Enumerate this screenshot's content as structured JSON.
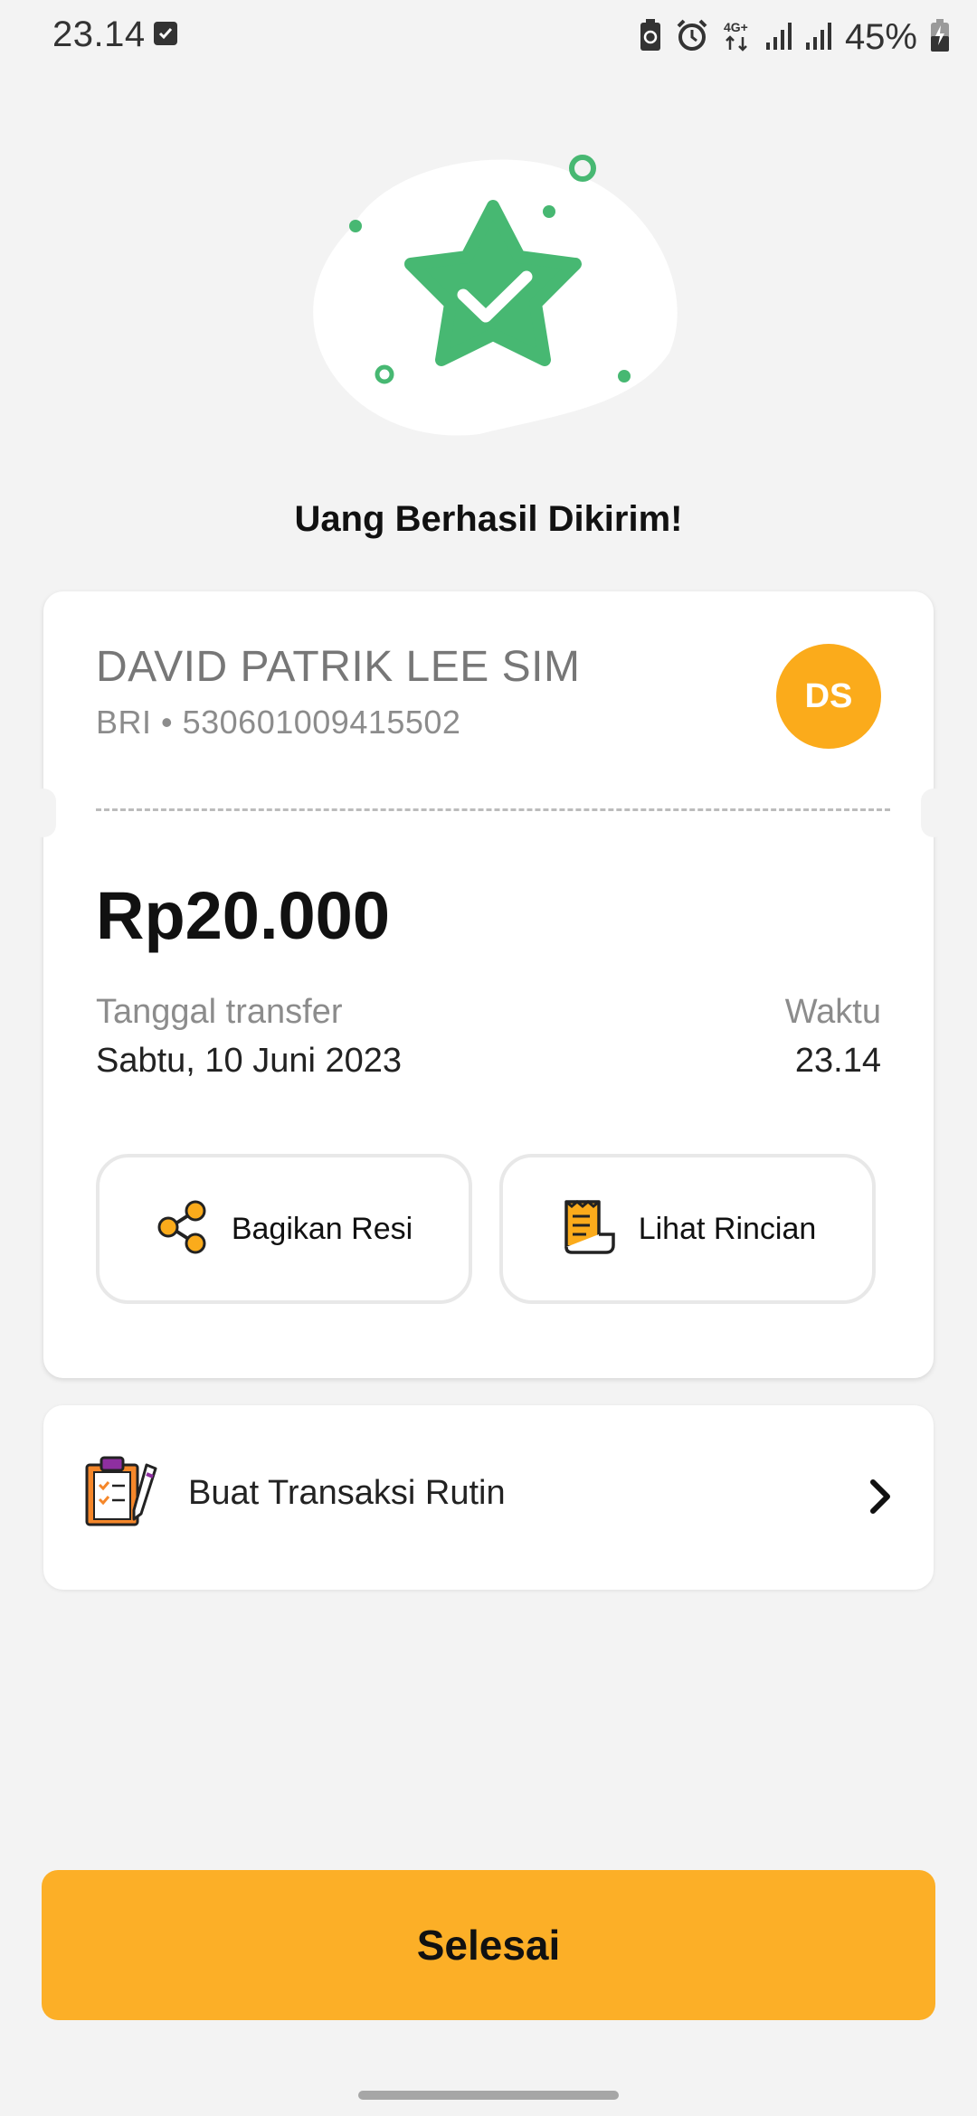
{
  "status_bar": {
    "time": "23.14",
    "network_label": "4G+",
    "battery_percent": "45%"
  },
  "success": {
    "title": "Uang Berhasil Dikirim!",
    "accent_color": "#47b872"
  },
  "recipient": {
    "name": "DAVID PATRIK LEE SIM",
    "account": "BRI • 530601009415502",
    "initials": "DS",
    "avatar_color": "#fbab1b"
  },
  "transfer": {
    "amount": "Rp20.000",
    "date_label": "Tanggal transfer",
    "date_value": "Sabtu, 10 Juni 2023",
    "time_label": "Waktu",
    "time_value": "23.14"
  },
  "actions": {
    "share_label": "Bagikan Resi",
    "detail_label": "Lihat Rincian"
  },
  "routine": {
    "label": "Buat Transaksi Rutin"
  },
  "footer": {
    "done_label": "Selesai",
    "button_color": "#fcaf27"
  },
  "icons": {
    "status_check": "check-square-icon",
    "share": "share-icon",
    "receipt": "receipt-icon",
    "clipboard": "clipboard-icon",
    "chevron": "chevron-right-icon"
  }
}
